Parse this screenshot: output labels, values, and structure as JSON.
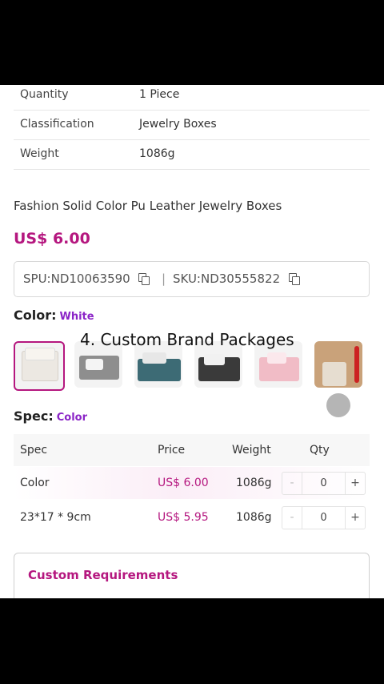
{
  "specs_table": [
    {
      "key": "Quantity",
      "value": "1 Piece"
    },
    {
      "key": "Classification",
      "value": "Jewelry Boxes"
    },
    {
      "key": "Weight",
      "value": "1086g"
    }
  ],
  "product": {
    "title": "Fashion Solid Color Pu Leather Jewelry Boxes",
    "price": "US$ 6.00",
    "spu": "SPU:ND10063590",
    "separator": "|",
    "sku": "SKU:ND30555822"
  },
  "color": {
    "label": "Color:",
    "selected": "White"
  },
  "overlay_caption": "4. Custom Brand Packages",
  "spec": {
    "label": "Spec:",
    "selected": "Color"
  },
  "variant_table": {
    "headers": [
      "Spec",
      "Price",
      "Weight",
      "Qty"
    ],
    "rows": [
      {
        "spec": "Color",
        "price": "US$ 6.00",
        "weight": "1086g",
        "qty": "0"
      },
      {
        "spec": "23*17 * 9cm",
        "price": "US$ 5.95",
        "weight": "1086g",
        "qty": "0"
      }
    ],
    "minus": "-",
    "plus": "+"
  },
  "custom_requirements": {
    "title": "Custom Requirements"
  },
  "colors": {
    "accent": "#b5177f",
    "purple": "#8b24c7"
  },
  "icons": [
    "copy-icon",
    "touch-indicator"
  ]
}
